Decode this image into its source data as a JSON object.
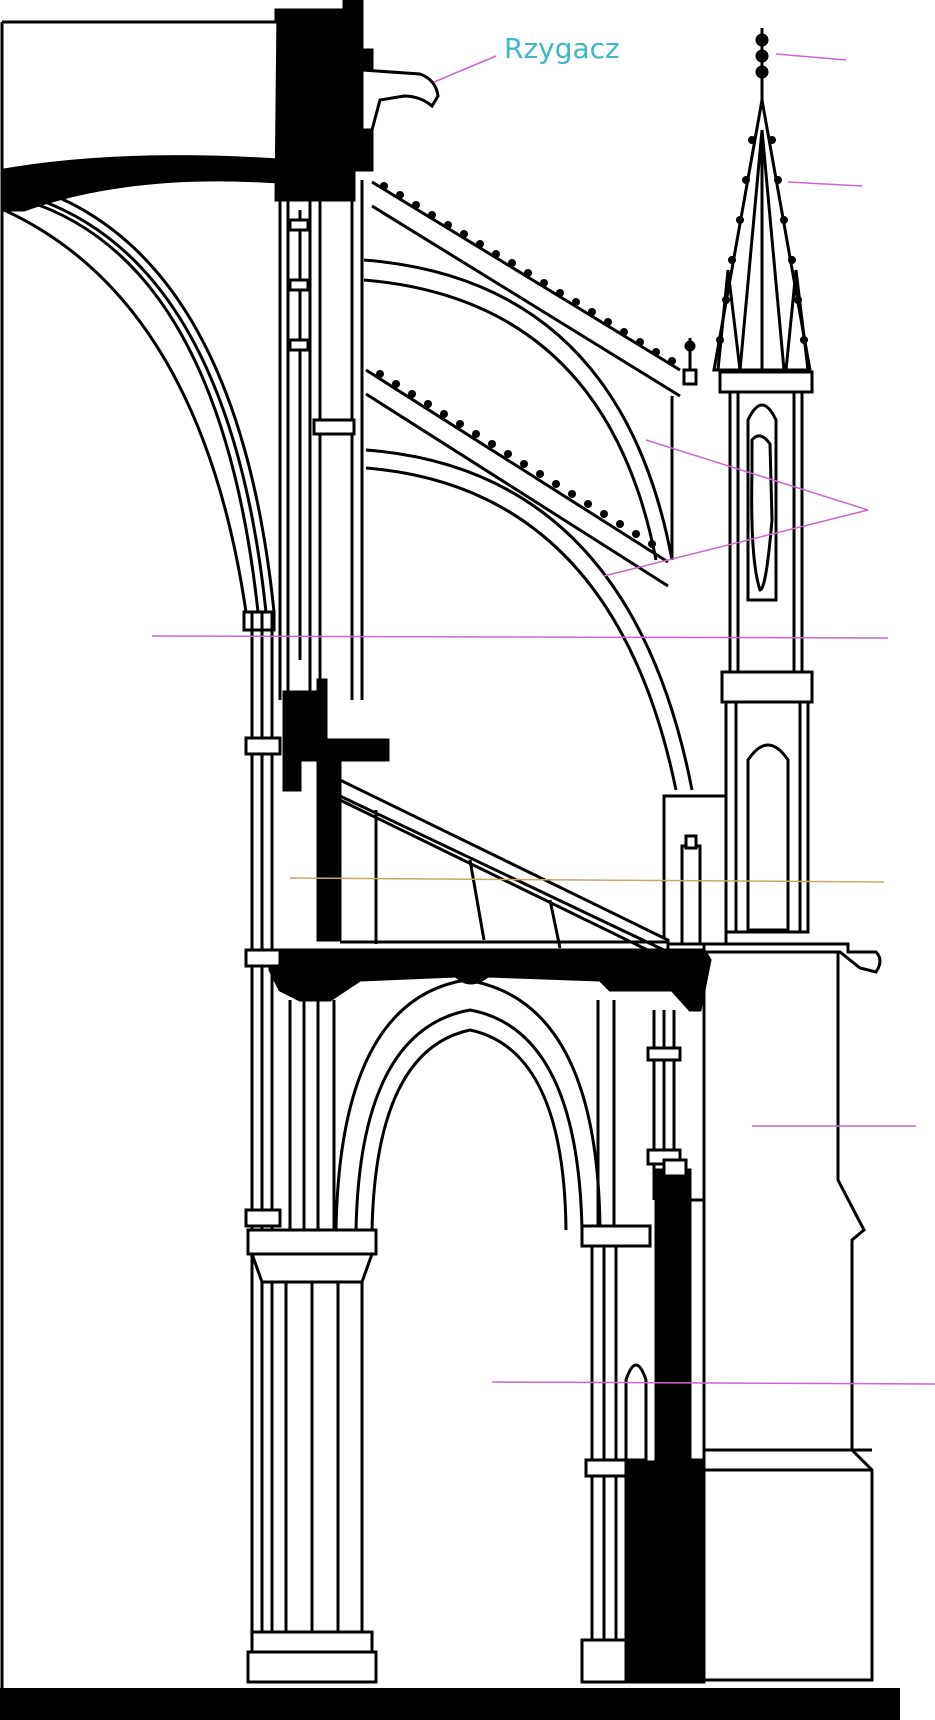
{
  "labels": {
    "gargoyle": "Rzygacz"
  },
  "colors": {
    "ink": "#000000",
    "paper": "#ffffff",
    "label_text": "#3fb8c4",
    "leader_line": "#cc66cc",
    "leader_line_alt": "#c9a868"
  }
}
